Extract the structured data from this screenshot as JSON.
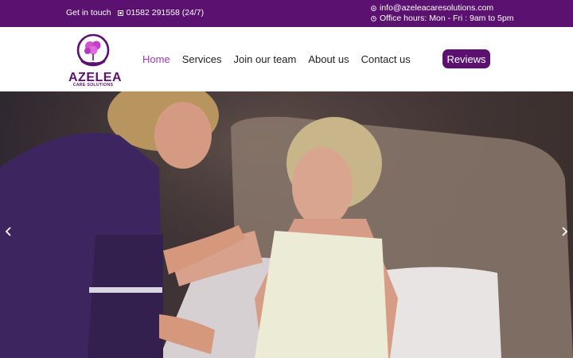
{
  "topbar": {
    "get_in_touch": "Get in touch",
    "phone": "01582 291558 (24/7)",
    "email": "info@azeleacaresolutions.com",
    "office_hours": "Office hours: Mon - Fri : 9am to 5pm"
  },
  "logo": {
    "brand": "AZELEA",
    "tagline": "CARE SOLUTIONS"
  },
  "nav": {
    "items": [
      {
        "label": "Home"
      },
      {
        "label": "Services"
      },
      {
        "label": "Join our team"
      },
      {
        "label": "About us"
      },
      {
        "label": "Contact us"
      }
    ],
    "reviews_label": "Reviews"
  },
  "hero": {
    "prev_icon": "chevron-left-icon",
    "next_icon": "chevron-right-icon"
  },
  "colors": {
    "brand_purple": "#5b1170",
    "nav_active": "#a23bb4"
  }
}
